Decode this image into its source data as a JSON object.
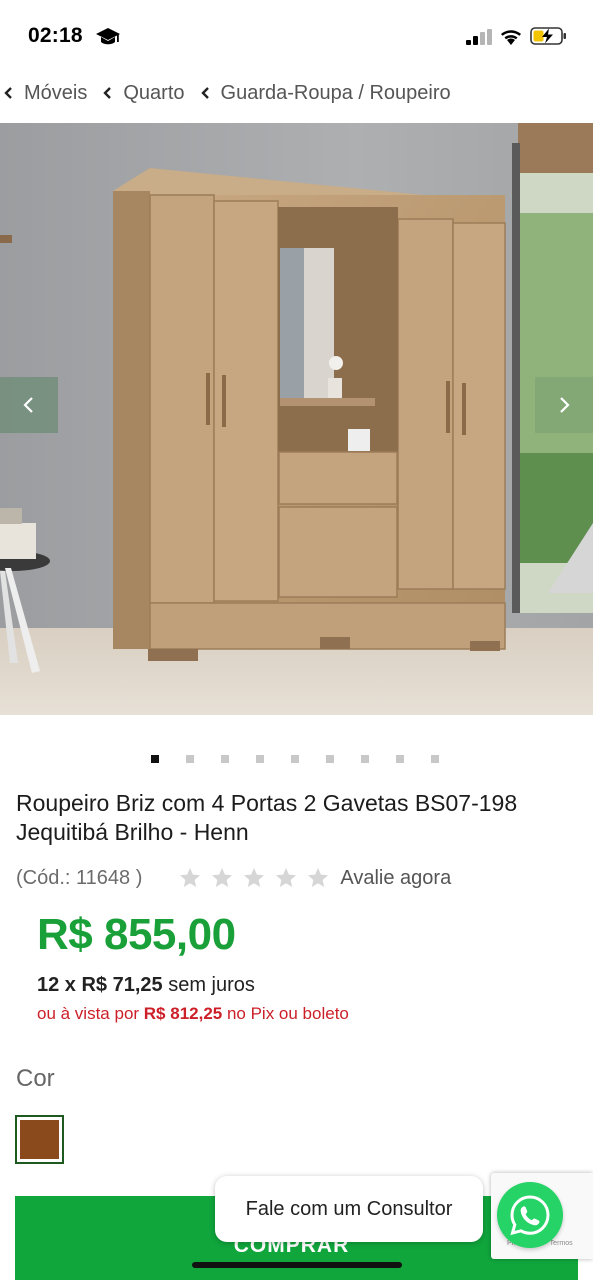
{
  "status_bar": {
    "time": "02:18",
    "icons": [
      "graduation-cap-icon",
      "signal-icon",
      "wifi-icon",
      "battery-charging-icon"
    ]
  },
  "breadcrumb": [
    {
      "label": "Móveis"
    },
    {
      "label": "Quarto"
    },
    {
      "label": "Guarda-Roupa / Roupeiro"
    }
  ],
  "gallery": {
    "image_alt": "Roupeiro Briz com 4 Portas 2 Gavetas",
    "prev_icon": "chevron-left-icon",
    "next_icon": "chevron-right-icon",
    "dot_count": 9,
    "active_dot": 1
  },
  "product": {
    "title": "Roupeiro Briz com 4 Portas 2 Gavetas BS07-198 Jequitibá Brilho - Henn",
    "code": "(Cód.: 11648 )",
    "rating_stars": 0,
    "rating_max": 5,
    "rate_link": "Avalie agora"
  },
  "pricing": {
    "price": "R$ 855,00",
    "installments_prefix": "12 x R$ 71,25",
    "installments_suffix": " sem juros",
    "cash_prefix": "ou à vista por ",
    "cash_price": "R$ 812,25",
    "cash_suffix": " no Pix ou boleto",
    "price_color": "#1aa038",
    "cash_color": "#cc1f28"
  },
  "color_option": {
    "label": "Cor",
    "selected_color": "#8a4a1c"
  },
  "buy_button": {
    "label": "COMPRAR",
    "color": "#10a63c"
  },
  "chat": {
    "consultant_label": "Fale com um Consultor",
    "whatsapp_icon": "whatsapp-icon",
    "recaptcha_terms": "Privacidade - Termos"
  }
}
